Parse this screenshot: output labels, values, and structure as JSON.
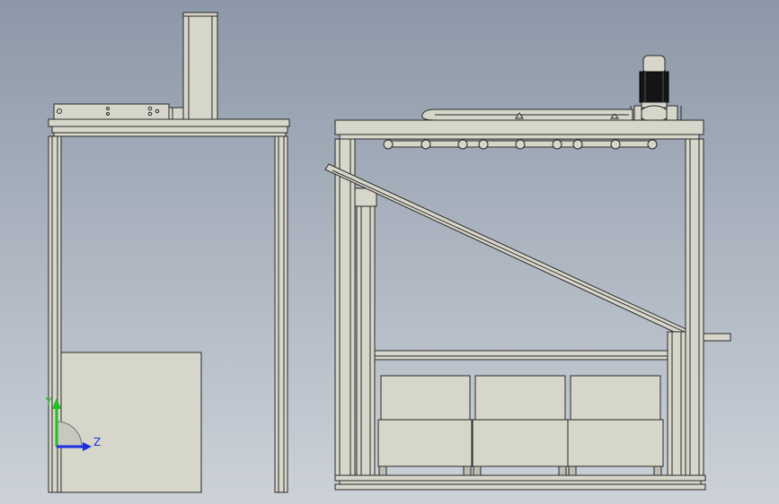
{
  "viewport": {
    "background_top": "#8c98a8",
    "background_bottom": "#cdd2d9",
    "part_color": "#d6d6ca",
    "edge_color": "#2a2a28"
  },
  "triad": {
    "y_label": "Y",
    "z_label": "Z",
    "y_color": "#1fbf1f",
    "z_color": "#1a2fe0"
  }
}
